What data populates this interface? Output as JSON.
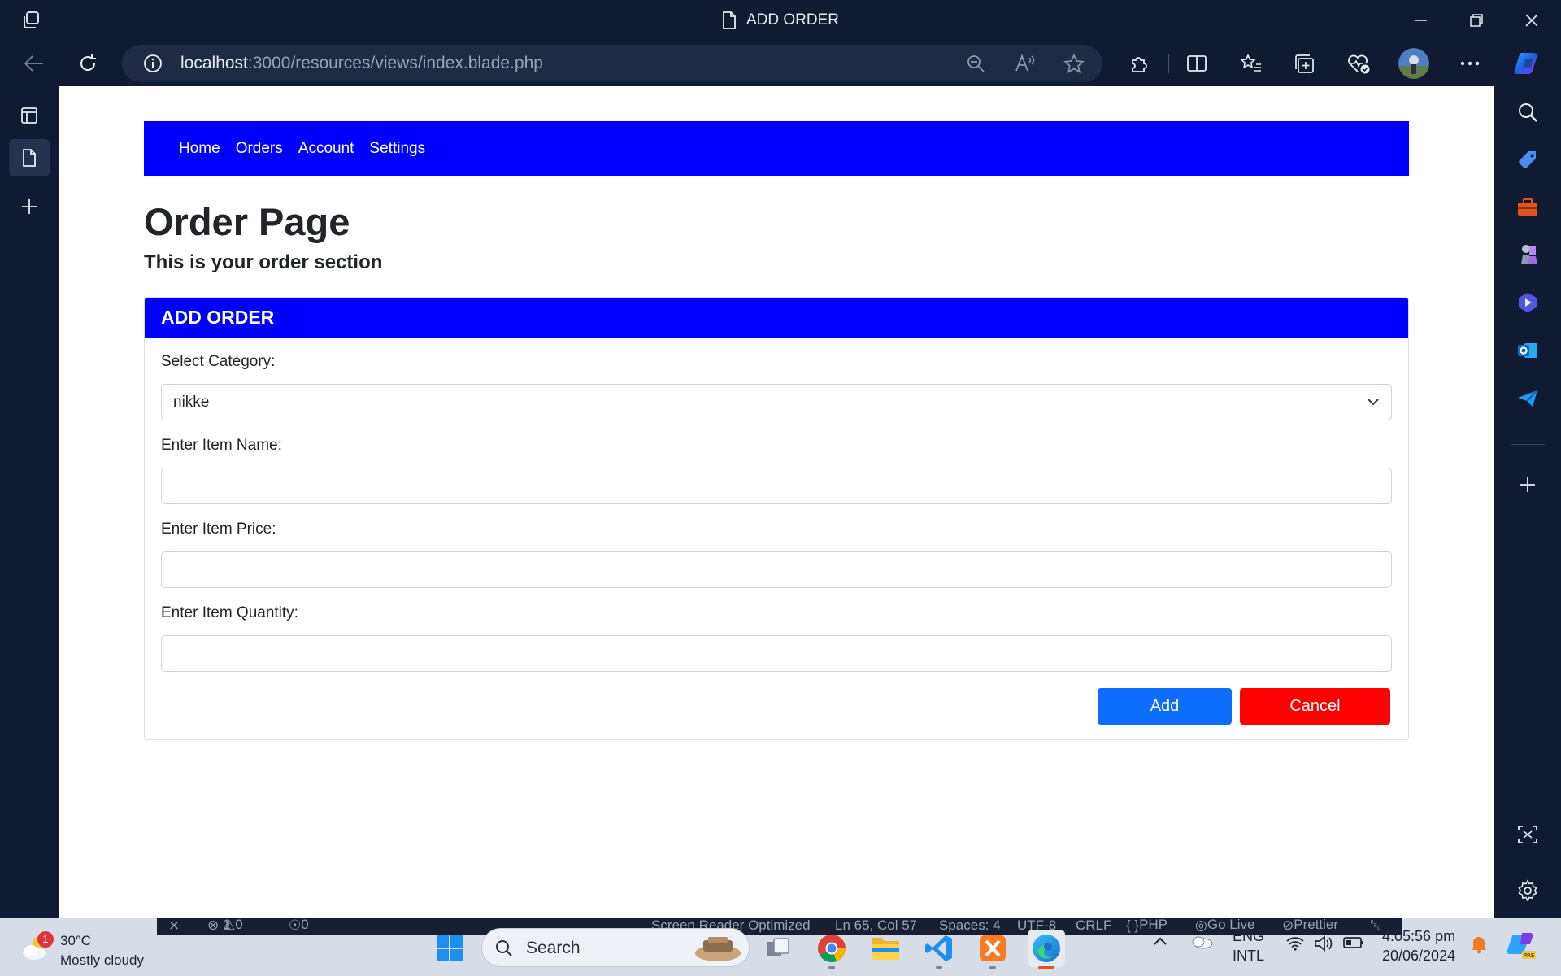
{
  "window": {
    "title": "ADD ORDER"
  },
  "browser": {
    "url_host": "localhost",
    "url_rest": ":3000/resources/views/index.blade.php"
  },
  "nav": {
    "items": [
      "Home",
      "Orders",
      "Account",
      "Settings"
    ]
  },
  "page": {
    "heading": "Order Page",
    "subtitle": "This is your order section"
  },
  "form": {
    "header": "ADD ORDER",
    "category_label": "Select Category:",
    "category_value": "nikke",
    "item_name_label": "Enter Item Name:",
    "item_name_value": "",
    "item_price_label": "Enter Item Price:",
    "item_price_value": "",
    "item_quantity_label": "Enter Item Quantity:",
    "item_quantity_value": "",
    "add_label": "Add",
    "cancel_label": "Cancel"
  },
  "colors": {
    "nav_bg": "#0000ff",
    "add_button": "#0d6efd",
    "cancel_button": "#ff0000"
  },
  "vscode_status": {
    "errors": "1",
    "warnings": "0",
    "ports": "0",
    "screen_reader": "Screen Reader Optimized",
    "position": "Ln 65, Col 57",
    "spaces": "Spaces: 4",
    "encoding": "UTF-8",
    "eol": "CRLF",
    "language": "PHP",
    "golive": "Go Live",
    "prettier": "Prettier"
  },
  "taskbar": {
    "weather_temp": "30°C",
    "weather_desc": "Mostly cloudy",
    "weather_badge": "1",
    "search_label": "Search",
    "lang_top": "ENG",
    "lang_bottom": "INTL",
    "time": "4:05:56 pm",
    "date": "20/06/2024"
  }
}
